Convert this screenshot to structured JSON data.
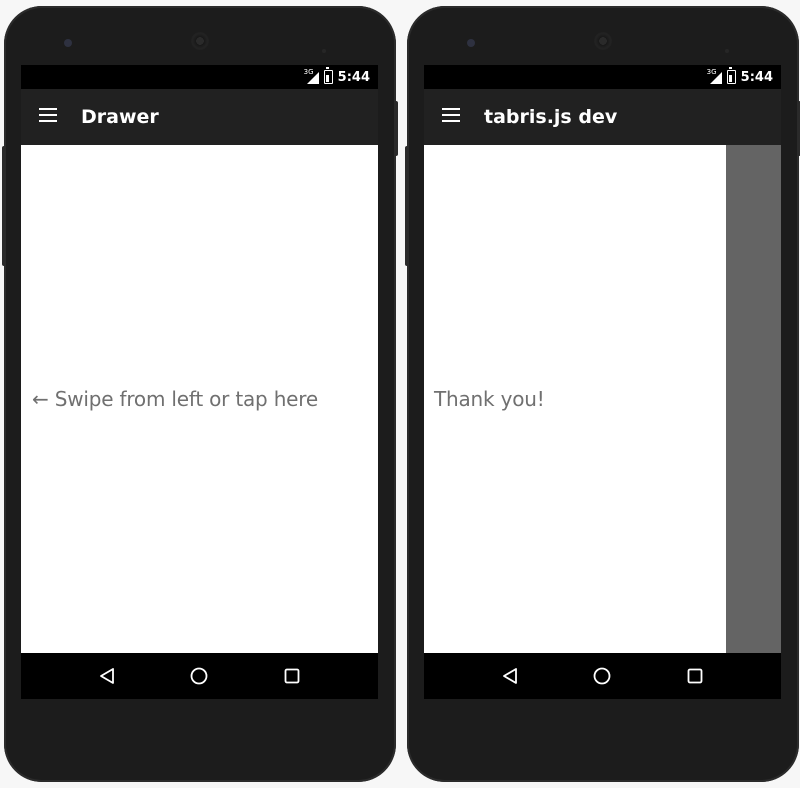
{
  "devices": [
    {
      "status": {
        "network": "3G",
        "time": "5:44"
      },
      "toolbar": {
        "title": "Drawer"
      },
      "content": {
        "message": "← Swipe from left or tap here"
      }
    },
    {
      "status": {
        "network": "3G",
        "time": "5:44"
      },
      "toolbar": {
        "title": "tabris.js dev"
      },
      "content": {
        "message": "Thank you!"
      }
    }
  ],
  "icons": {
    "menu": "hamburger-menu-icon",
    "back": "triangle-back-icon",
    "home": "circle-home-icon",
    "recents": "square-recents-icon"
  },
  "colors": {
    "toolbar": "#212121",
    "status_bar": "#000000",
    "message_text": "#707070",
    "drawer_scrim": "#646464",
    "phone_body": "#1c1c1c"
  }
}
